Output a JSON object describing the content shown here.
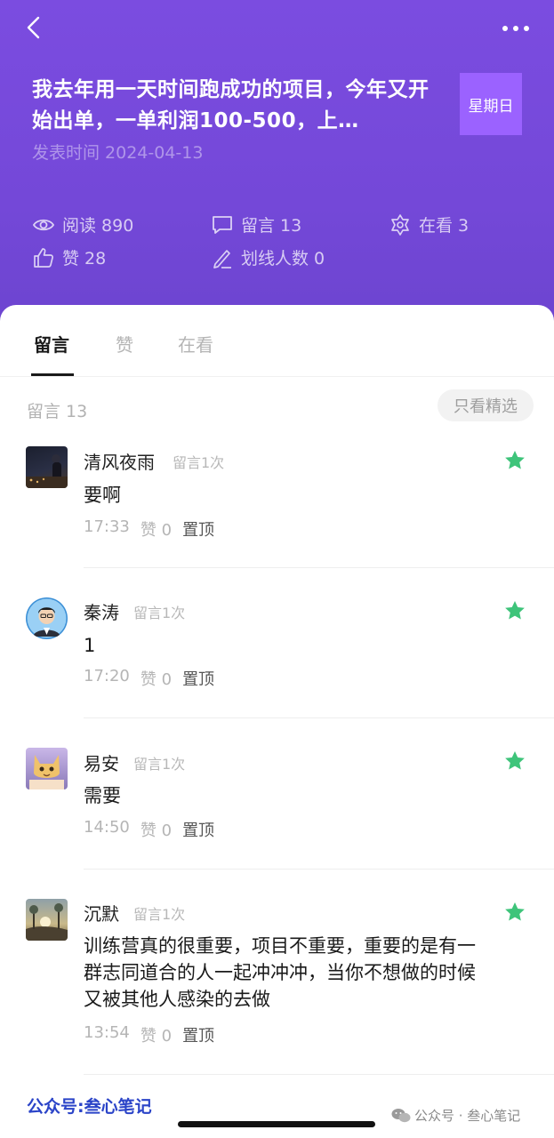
{
  "header": {
    "title": "我去年用一天时间跑成功的项目，今年又开始出单，一单利润100-500，上…",
    "weekday_badge": "星期日",
    "publish_time": "发表时间 2024-04-13",
    "stats": {
      "read": "阅读 890",
      "comments": "留言 13",
      "watching": "在看 3",
      "likes": "赞 28",
      "underline": "划线人数 0"
    }
  },
  "tabs": [
    {
      "label": "留言",
      "active": true
    },
    {
      "label": "赞",
      "active": false
    },
    {
      "label": "在看",
      "active": false
    }
  ],
  "comment_section": {
    "count_label": "留言 13",
    "featured_button": "只看精选"
  },
  "comments": [
    {
      "name": "清风夜雨",
      "tag": "留言1次",
      "text": "要啊",
      "time": "17:33",
      "likes": "赞 0",
      "pin": "置顶"
    },
    {
      "name": "秦涛",
      "tag": "留言1次",
      "text": "1",
      "time": "17:20",
      "likes": "赞 0",
      "pin": "置顶"
    },
    {
      "name": "易安",
      "tag": "留言1次",
      "text": "需要",
      "time": "14:50",
      "likes": "赞 0",
      "pin": "置顶"
    },
    {
      "name": "沉默",
      "tag": "留言1次",
      "text": "训练营真的很重要，项目不重要，重要的是有一群志同道合的人一起冲冲冲，当你不想做的时候又被其他人感染的去做",
      "time": "13:54",
      "likes": "赞 0",
      "pin": "置顶"
    }
  ],
  "watermarks": {
    "left": "公众号:叁心笔记",
    "right": "公众号 · 叁心笔记"
  },
  "colors": {
    "header_bg": "#7b4ce0",
    "badge_bg": "#9b62ff",
    "star": "#3ec47a"
  }
}
